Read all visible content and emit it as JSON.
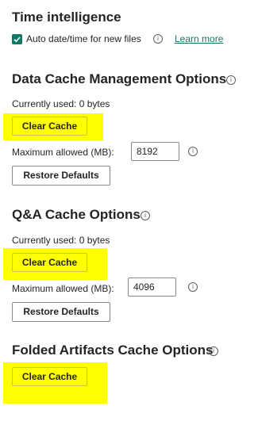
{
  "time_intelligence": {
    "title": "Time intelligence",
    "auto_date_label": "Auto date/time for new files",
    "auto_date_checked": true,
    "learn_more": "Learn more"
  },
  "data_cache": {
    "title": "Data Cache Management Options",
    "currently_used": "Currently used: 0 bytes",
    "clear_cache": "Clear Cache",
    "max_allowed_label": "Maximum allowed (MB):",
    "max_allowed_value": "8192",
    "restore_defaults": "Restore Defaults"
  },
  "qa_cache": {
    "title": "Q&A Cache Options",
    "currently_used": "Currently used: 0 bytes",
    "clear_cache": "Clear Cache",
    "max_allowed_label": "Maximum allowed (MB):",
    "max_allowed_value": "4096",
    "restore_defaults": "Restore Defaults"
  },
  "folded_artifacts": {
    "title": "Folded Artifacts Cache Options",
    "clear_cache": "Clear Cache"
  },
  "icons": {
    "info": "i",
    "check": "✓"
  },
  "colors": {
    "highlight": "#ffff00",
    "accent": "#117865",
    "text": "#252423"
  }
}
